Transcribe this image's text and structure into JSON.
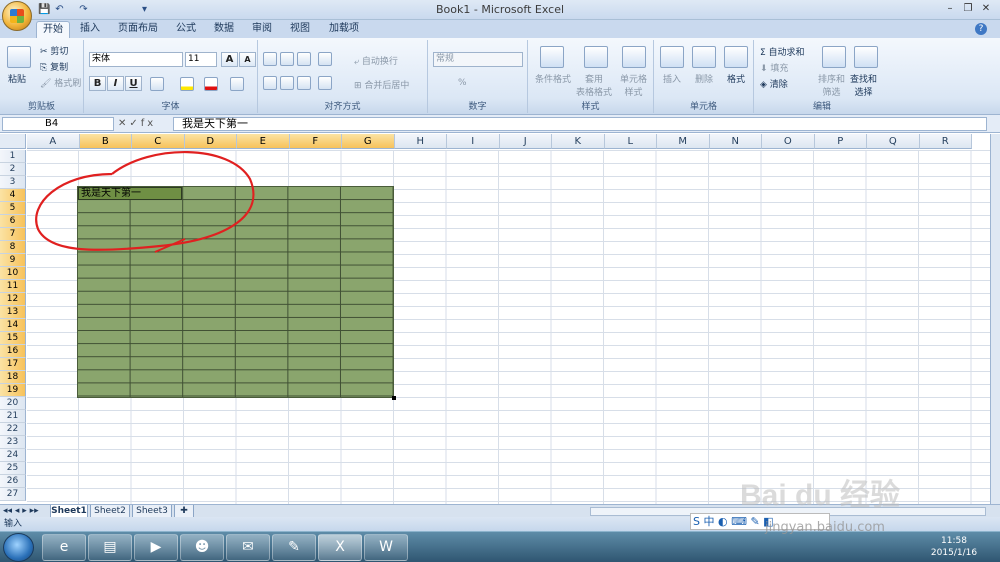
{
  "window": {
    "title": "Book1 - Microsoft Excel",
    "minimize": "–",
    "restore": "❐",
    "close": "✕"
  },
  "qat": {
    "save": "💾",
    "undo": "↶",
    "redo": "↷",
    "more": "▾"
  },
  "tabs": [
    {
      "label": "开始"
    },
    {
      "label": "插入"
    },
    {
      "label": "页面布局"
    },
    {
      "label": "公式"
    },
    {
      "label": "数据"
    },
    {
      "label": "审阅"
    },
    {
      "label": "视图"
    },
    {
      "label": "加载项"
    }
  ],
  "ribbon": {
    "clipboard": {
      "group": "剪贴板",
      "paste": "粘贴",
      "cut": "剪切",
      "copy": "复制",
      "format_painter": "格式刷"
    },
    "font": {
      "group": "字体",
      "font_name": "宋体",
      "font_size": "11",
      "grow": "A",
      "shrink": "A",
      "bold": "B",
      "italic": "I",
      "underline": "U"
    },
    "alignment": {
      "group": "对齐方式",
      "wrap": "自动换行",
      "merge": "合并后居中"
    },
    "number": {
      "group": "数字",
      "format": "常规",
      "percent": "%"
    },
    "styles": {
      "group": "样式",
      "conditional": "条件格式",
      "table": "套用\n表格格式",
      "cell_styles": "单元格\n样式"
    },
    "cells": {
      "group": "单元格",
      "insert": "插入",
      "delete": "删除",
      "format": "格式"
    },
    "editing": {
      "group": "编辑",
      "autosum": "Σ 自动求和",
      "fill": "填充",
      "clear": "清除",
      "sort": "排序和\n筛选",
      "find": "查找和\n选择"
    }
  },
  "formula_bar": {
    "name_box": "B4",
    "fx": "fx",
    "content": "我是天下第一"
  },
  "columns": [
    "A",
    "B",
    "C",
    "D",
    "E",
    "F",
    "G",
    "H",
    "I",
    "J",
    "K",
    "L",
    "M",
    "N",
    "O",
    "P",
    "Q",
    "R"
  ],
  "rows": [
    "1",
    "2",
    "3",
    "4",
    "5",
    "6",
    "7",
    "8",
    "9",
    "10",
    "11",
    "12",
    "13",
    "14",
    "15",
    "16",
    "17",
    "18",
    "19",
    "20",
    "21",
    "22",
    "23",
    "24",
    "25",
    "26",
    "27"
  ],
  "cell_b4": "我是天下第一",
  "sheets": [
    {
      "label": "Sheet1"
    },
    {
      "label": "Sheet2"
    },
    {
      "label": "Sheet3"
    }
  ],
  "status": "输入",
  "ime": "S 中 ◐ ⌨ ✎ ◧",
  "tray": {
    "time": "11:58",
    "date": "2015/1/16"
  },
  "colors": {
    "range_fill": "#8aa56d",
    "active_cell": "#6f8f44",
    "annotation": "#e02020"
  },
  "watermark": {
    "logo": "Bai du 经验",
    "url": "jingyan.baidu.com"
  }
}
